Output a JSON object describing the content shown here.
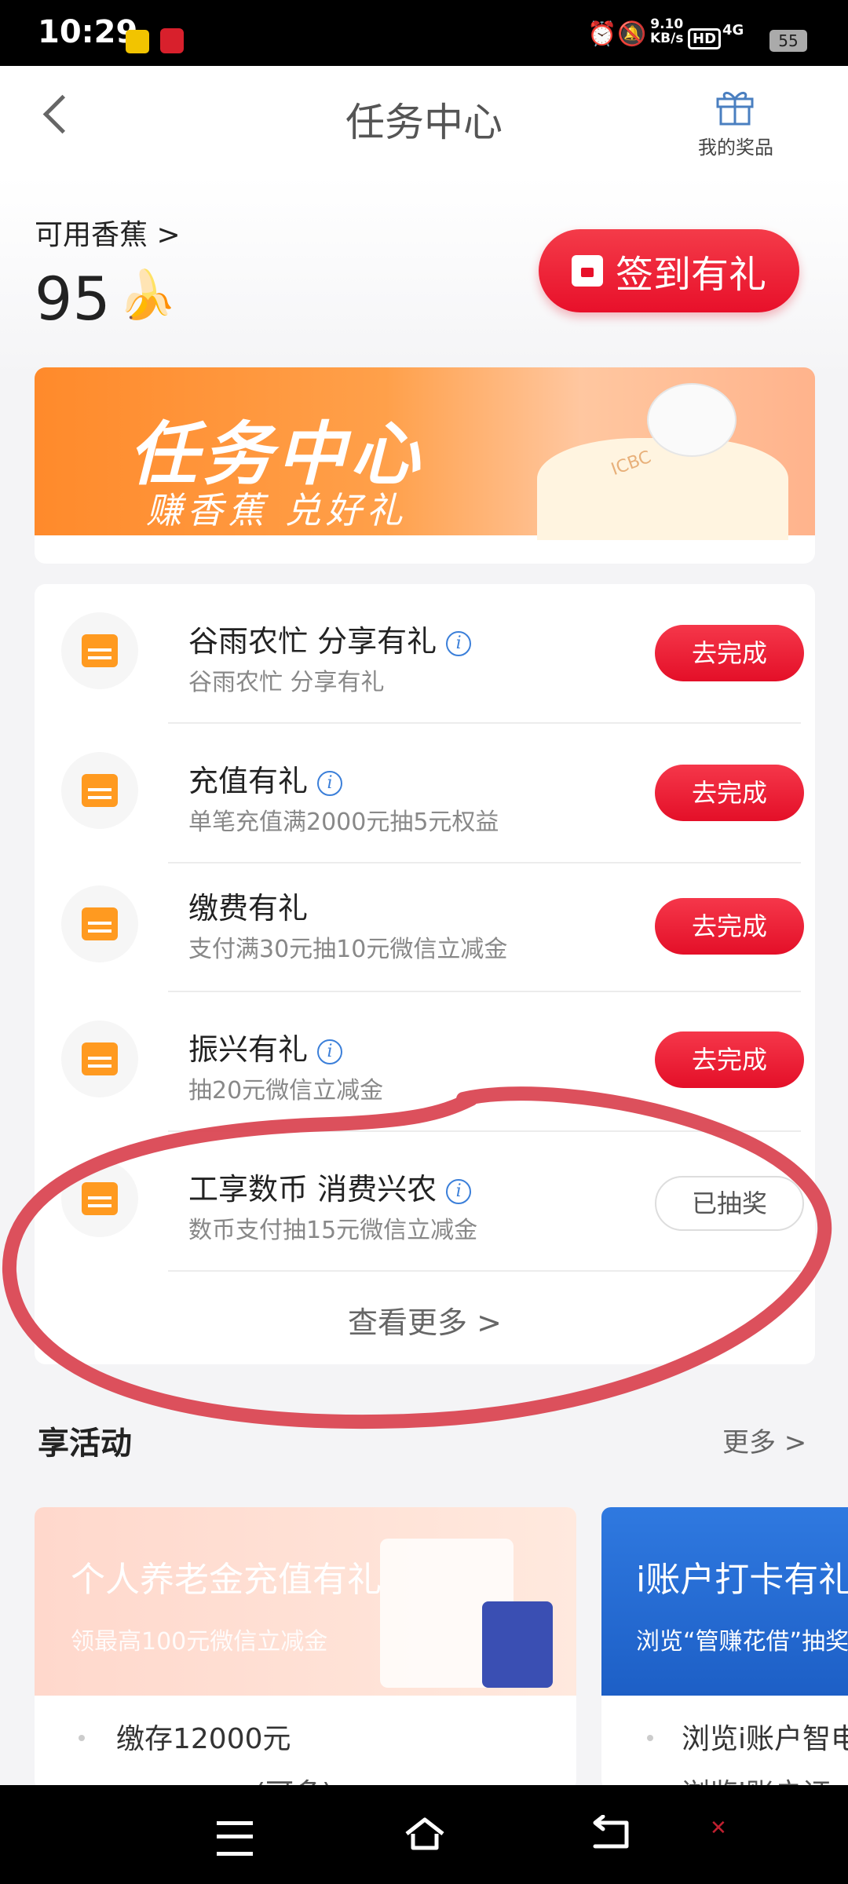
{
  "status_bar": {
    "time": "10:29",
    "speed_value": "9.10",
    "speed_unit": "KB/s",
    "hd": "HD",
    "network": "4G",
    "battery": "55"
  },
  "nav": {
    "title": "任务中心",
    "prizes_label": "我的奖品"
  },
  "header": {
    "available_label": "可用香蕉 >",
    "banana_count": "95",
    "banana_emoji": "🍌",
    "signin_label": "签到有礼"
  },
  "banner": {
    "title": "任务中心",
    "subtitle": "赚香蕉 兑好礼",
    "logo_text": "ICBC"
  },
  "tasks": [
    {
      "title": "谷雨农忙 分享有礼",
      "desc": "谷雨农忙 分享有礼",
      "button": "去完成",
      "has_info": true
    },
    {
      "title": "充值有礼",
      "desc": "单笔充值满2000元抽5元权益",
      "button": "去完成",
      "has_info": true
    },
    {
      "title": "缴费有礼",
      "desc": "支付满30元抽10元微信立减金",
      "button": "去完成",
      "has_info": false
    },
    {
      "title": "振兴有礼",
      "desc": "抽20元微信立减金",
      "button": "去完成",
      "has_info": true
    },
    {
      "title": "工享数币 消费兴农",
      "desc": "数币支付抽15元微信立减金",
      "button": "已抽奖",
      "has_info": true
    }
  ],
  "info_glyph": "i",
  "more_label": "查看更多 >",
  "activities": {
    "section_title": "享活动",
    "more_label": "更多 >",
    "cards": [
      {
        "title": "个人养老金充值有礼",
        "subtitle": "领最高100元微信立减金",
        "items": [
          "缴存12000元",
          "(可多)"
        ]
      },
      {
        "title": "i账户打卡有礼",
        "subtitle": "浏览“管赚花借”抽奖",
        "items": [
          "浏览i账户智电",
          "浏览i账户证..."
        ]
      }
    ]
  },
  "colors": {
    "accent_red": "#e8102a",
    "task_icon_orange": "#ff9a20",
    "annotation_red": "#d9414e",
    "info_blue": "#3b7fd9"
  },
  "icons": [
    "back-chevron-icon",
    "gift-icon",
    "banana-icon",
    "calendar-icon",
    "info-icon",
    "menu-icon",
    "home-icon",
    "back-icon"
  ]
}
